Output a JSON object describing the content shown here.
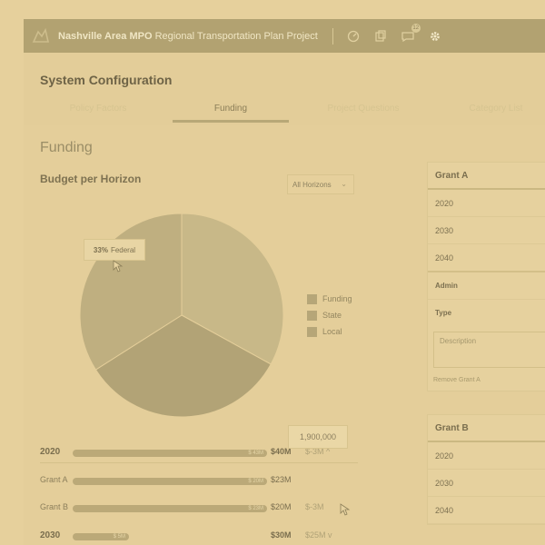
{
  "header": {
    "org": "Nashville Area MPO",
    "project": "Regional Transportation Plan Project",
    "icons": [
      "dashboard-icon",
      "documents-icon",
      "messages-icon",
      "settings-icon"
    ],
    "message_badge": "12"
  },
  "page": {
    "title": "System Configuration",
    "tabs": [
      {
        "label": "Policy Factors",
        "active": false
      },
      {
        "label": "Funding",
        "active": true
      },
      {
        "label": "Project Questions",
        "active": false
      },
      {
        "label": "Category List",
        "active": false
      }
    ]
  },
  "funding": {
    "section_title": "Funding",
    "chart_title": "Budget per Horizon",
    "filter": "All Horizons",
    "tooltip": {
      "percent": "33%",
      "label": "Federal"
    },
    "legend": [
      "Funding",
      "State",
      "Local"
    ],
    "rows": [
      {
        "label": "2020",
        "bar_value": "$ 43M",
        "amount": "$40M",
        "delta": "$-3M",
        "fill": 0.93,
        "group": true,
        "chevron": "^"
      },
      {
        "label": "Grant A",
        "bar_value": "$ 20M",
        "amount": "$23M",
        "delta": "",
        "fill": 0.93,
        "group": false
      },
      {
        "label": "Grant B",
        "bar_value": "$ 23M",
        "amount": "$20M",
        "delta": "$-3M",
        "fill": 0.93,
        "group": false
      },
      {
        "label": "2030",
        "bar_value": "$ 5M",
        "amount": "$30M",
        "delta": "$25M",
        "fill": 0.27,
        "group": true,
        "chevron": "v"
      }
    ],
    "edit_tooltip": "1,900,000"
  },
  "chart_data": {
    "type": "pie",
    "title": "Budget per Horizon",
    "categories": [
      "Funding",
      "State",
      "Local"
    ],
    "values": [
      33,
      33,
      34
    ],
    "tooltip": "33% Federal"
  },
  "grants": [
    {
      "name": "Grant A",
      "years": [
        "2020",
        "2030",
        "2040"
      ],
      "admin_label": "Admin",
      "type_label": "Type",
      "description_placeholder": "Description",
      "remove_label": "Remove Grant A"
    },
    {
      "name": "Grant B",
      "years": [
        "2020",
        "2030",
        "2040"
      ]
    }
  ],
  "colors": {
    "background": "#e6d09c",
    "header": "#b2a271",
    "pie_light": "#c8b888",
    "pie_dark": "#b2a376"
  }
}
